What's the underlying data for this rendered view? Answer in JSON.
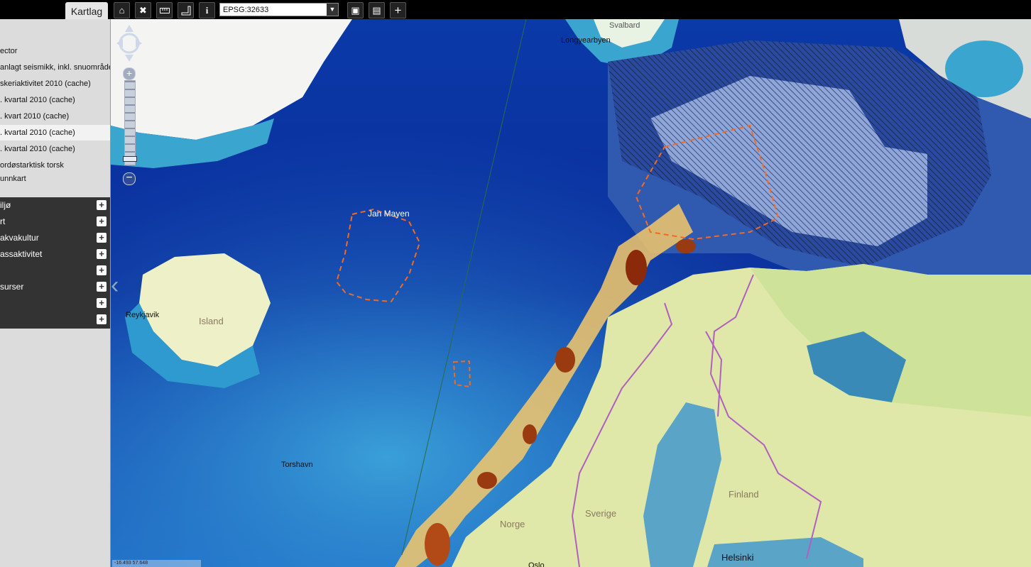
{
  "tab": {
    "label": "Kartlag"
  },
  "toolbar": {
    "buttons": [
      {
        "icon": "home-icon",
        "glyph": "⌂"
      },
      {
        "icon": "tools-icon",
        "glyph": "✖"
      },
      {
        "icon": "measure-length-icon",
        "glyph": "▭"
      },
      {
        "icon": "measure-area-icon",
        "glyph": "▟"
      },
      {
        "icon": "info-icon",
        "glyph": "i"
      }
    ],
    "crs_value": "EPSG:32633",
    "extra_buttons": [
      {
        "icon": "save-icon",
        "glyph": "▣"
      },
      {
        "icon": "database-icon",
        "glyph": "▤"
      },
      {
        "icon": "add-icon",
        "glyph": "+"
      }
    ]
  },
  "sidebar": {
    "layers": [
      {
        "label": "ector",
        "selected": false
      },
      {
        "label": "anlagt seismikk, inkl. snuområde",
        "selected": false
      },
      {
        "label": "skeriaktivitet 2010 (cache)",
        "selected": false
      },
      {
        "label": ". kvartal 2010 (cache)",
        "selected": false
      },
      {
        "label": ". kvart 2010 (cache)",
        "selected": false
      },
      {
        "label": ". kvartal 2010 (cache)",
        "selected": true
      },
      {
        "label": ". kvartal 2010 (cache)",
        "selected": false
      },
      {
        "label": "ordøstarktisk torsk",
        "selected": false
      },
      {
        "label": "unnkart",
        "selected": false
      }
    ],
    "groups": [
      {
        "label": "iljø"
      },
      {
        "label": "rt"
      },
      {
        "label": "akvakultur"
      },
      {
        "label": "assaktivitet"
      },
      {
        "label": ""
      },
      {
        "label": "surser"
      },
      {
        "label": ""
      },
      {
        "label": ""
      }
    ]
  },
  "map": {
    "places": [
      {
        "name": "Longyearbyen"
      },
      {
        "name": "Svalbard"
      },
      {
        "name": "Jan Mayen"
      },
      {
        "name": "Reykjavik"
      },
      {
        "name": "Torshavn"
      },
      {
        "name": "Helsinki"
      },
      {
        "name": "Oslo"
      }
    ],
    "countries": [
      {
        "name": "Island"
      },
      {
        "name": "Norge"
      },
      {
        "name": "Sverige"
      },
      {
        "name": "Finland"
      }
    ],
    "coordinate_readout": "-16.493 57.648"
  }
}
